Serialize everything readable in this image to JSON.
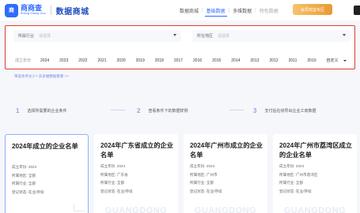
{
  "header": {
    "logo_mark": "商",
    "logo_cn": "商商查",
    "logo_en": "Shang Shang Cha",
    "site_title": "数据商城",
    "nav": [
      {
        "label": "数据商城",
        "state": "normal"
      },
      {
        "label": "基础数据",
        "state": "active"
      },
      {
        "label": "多维数据",
        "state": "normal"
      },
      {
        "label": "特色数据",
        "state": "muted"
      }
    ],
    "vip_label": "会员权益专区"
  },
  "filters": {
    "industry": {
      "label": "所属行业",
      "placeholder": "请选择"
    },
    "region": {
      "label": "所在地区",
      "placeholder": "请选择"
    },
    "year_label": "成立年份",
    "years": [
      "2024",
      "2023",
      "2022",
      "2021",
      "2020",
      "2019",
      "2018",
      "2017",
      "2016",
      "2015",
      "2014",
      "2013",
      "2012",
      "2011",
      "2010"
    ],
    "custom_label": "自定义"
  },
  "hint": "筛选条件太少? 去多维数据看看 >>",
  "steps": [
    {
      "num": "1",
      "label": "选择所需要的企业条件"
    },
    {
      "num": "2",
      "label": "查看条件下的数据样例"
    },
    {
      "num": "3",
      "label": "支付后在线导出企业工商数据"
    }
  ],
  "cards": [
    {
      "title": "2024年成立的企业名单",
      "year": "成立年份: 2024",
      "region": "所属地区: 全部",
      "industry": "所属行业: 全部",
      "status": "登记状态: 在业/存续",
      "watermark": "",
      "selected": true
    },
    {
      "title": "2024年广东省成立的企业名单",
      "year": "成立年份: 2024",
      "region": "所属地区: 广东省",
      "industry": "所属行业: 全部",
      "status": "登记状态: 在业/存续",
      "watermark": "GUANGDONG",
      "selected": false
    },
    {
      "title": "2024年广州市成立的企业名单",
      "year": "成立年份: 2024",
      "region": "所属地区: 广州市",
      "industry": "所属行业: 全部",
      "status": "登记状态: 在业/存续",
      "watermark": "GUANGDONG",
      "selected": false
    },
    {
      "title": "2024年广州市荔湾区成立的企业名单",
      "year": "成立年份: 2024",
      "region": "所属地区: 广州市荔湾区",
      "industry": "所属行业: 全部",
      "status": "登记状态: 在业/存续",
      "watermark": "GUANGDONG",
      "selected": false
    }
  ]
}
